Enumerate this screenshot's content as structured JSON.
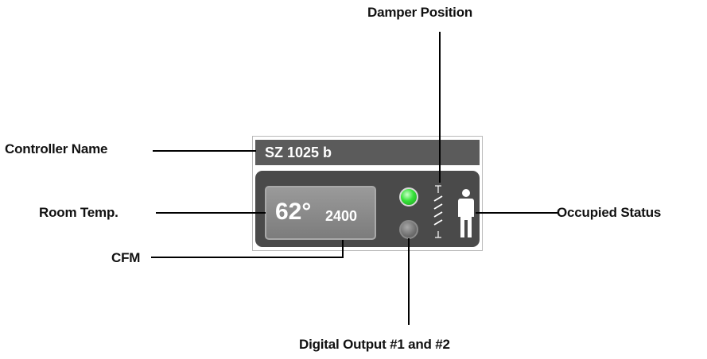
{
  "callouts": {
    "controller_name": "Controller Name",
    "room_temp": "Room Temp.",
    "cfm": "CFM",
    "damper_position": "Damper Position",
    "occupied_status": "Occupied Status",
    "digital_output": "Digital Output #1 and  #2"
  },
  "widget": {
    "controller_name": "SZ 1025 b",
    "room_temp": "62°",
    "cfm": "2400",
    "digital_output_1": "on",
    "digital_output_2": "off",
    "occupied": true,
    "icons": [
      "damper-position-icon",
      "occupied-person-icon"
    ],
    "colors": {
      "title_bar": "#5b5b5b",
      "panel": "#4a4a4a",
      "led_on": "#37e23a",
      "led_off": "#6f6f6f",
      "leader_line": "#000000"
    }
  }
}
